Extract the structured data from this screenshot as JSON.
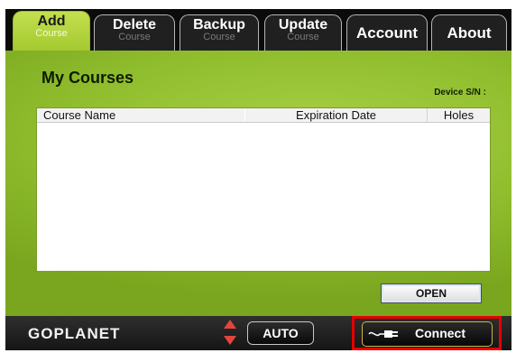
{
  "tabs": [
    {
      "main": "Add",
      "sub": "Course",
      "active": true
    },
    {
      "main": "Delete",
      "sub": "Course"
    },
    {
      "main": "Backup",
      "sub": "Course"
    },
    {
      "main": "Update",
      "sub": "Course"
    },
    {
      "main": "Account"
    },
    {
      "main": "About"
    }
  ],
  "panel": {
    "title": "My Courses",
    "device_sn_label": "Device S/N :",
    "columns": [
      "Course Name",
      "Expiration Date",
      "Holes"
    ],
    "rows": []
  },
  "open_button": "OPEN",
  "bottom": {
    "brand": "GOPLANET",
    "auto_label": "AUTO",
    "connect_label": "Connect"
  },
  "colors": {
    "panel_green": "#8fbd2d",
    "highlight_red": "#e60000",
    "arrow_red": "#e3453a"
  }
}
